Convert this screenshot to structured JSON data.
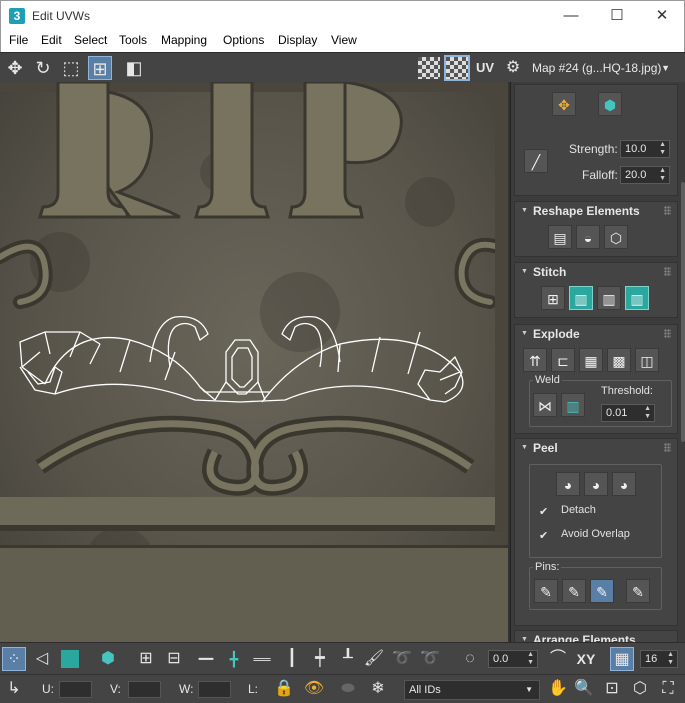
{
  "window": {
    "title": "Edit UVWs",
    "app_icon": "3",
    "controls": {
      "minimize": "—",
      "maximize": "☐",
      "close": "✕"
    }
  },
  "menu": [
    "File",
    "Edit",
    "Select",
    "Tools",
    "Mapping",
    "Options",
    "Display",
    "View"
  ],
  "toolbar": {
    "uv_label": "UV",
    "map_dropdown": "Map #24 (g...HQ-18.jpg)"
  },
  "panel": {
    "brush": {
      "strength_label": "Strength:",
      "strength_value": "10.0",
      "falloff_label": "Falloff:",
      "falloff_value": "20.0"
    },
    "reshape": {
      "title": "Reshape Elements"
    },
    "stitch": {
      "title": "Stitch"
    },
    "explode": {
      "title": "Explode",
      "weld_label": "Weld",
      "threshold_label": "Threshold:",
      "threshold_value": "0.01"
    },
    "peel": {
      "title": "Peel",
      "detach_label": "Detach",
      "avoid_overlap_label": "Avoid Overlap",
      "pins_label": "Pins:"
    },
    "arrange": {
      "title": "Arrange Elements"
    }
  },
  "bottom": {
    "rotate_value": "0.0",
    "xy_label": "XY",
    "grid_value": "16",
    "u_label": "U:",
    "v_label": "V:",
    "w_label": "W:",
    "l_label": "L:",
    "ids_dropdown": "All IDs"
  },
  "viewport": {
    "texture_text": "RIP"
  },
  "colors": {
    "accent": "#2aa8a0",
    "active_tool": "#5a7fa6",
    "panel_bg": "#444444"
  }
}
